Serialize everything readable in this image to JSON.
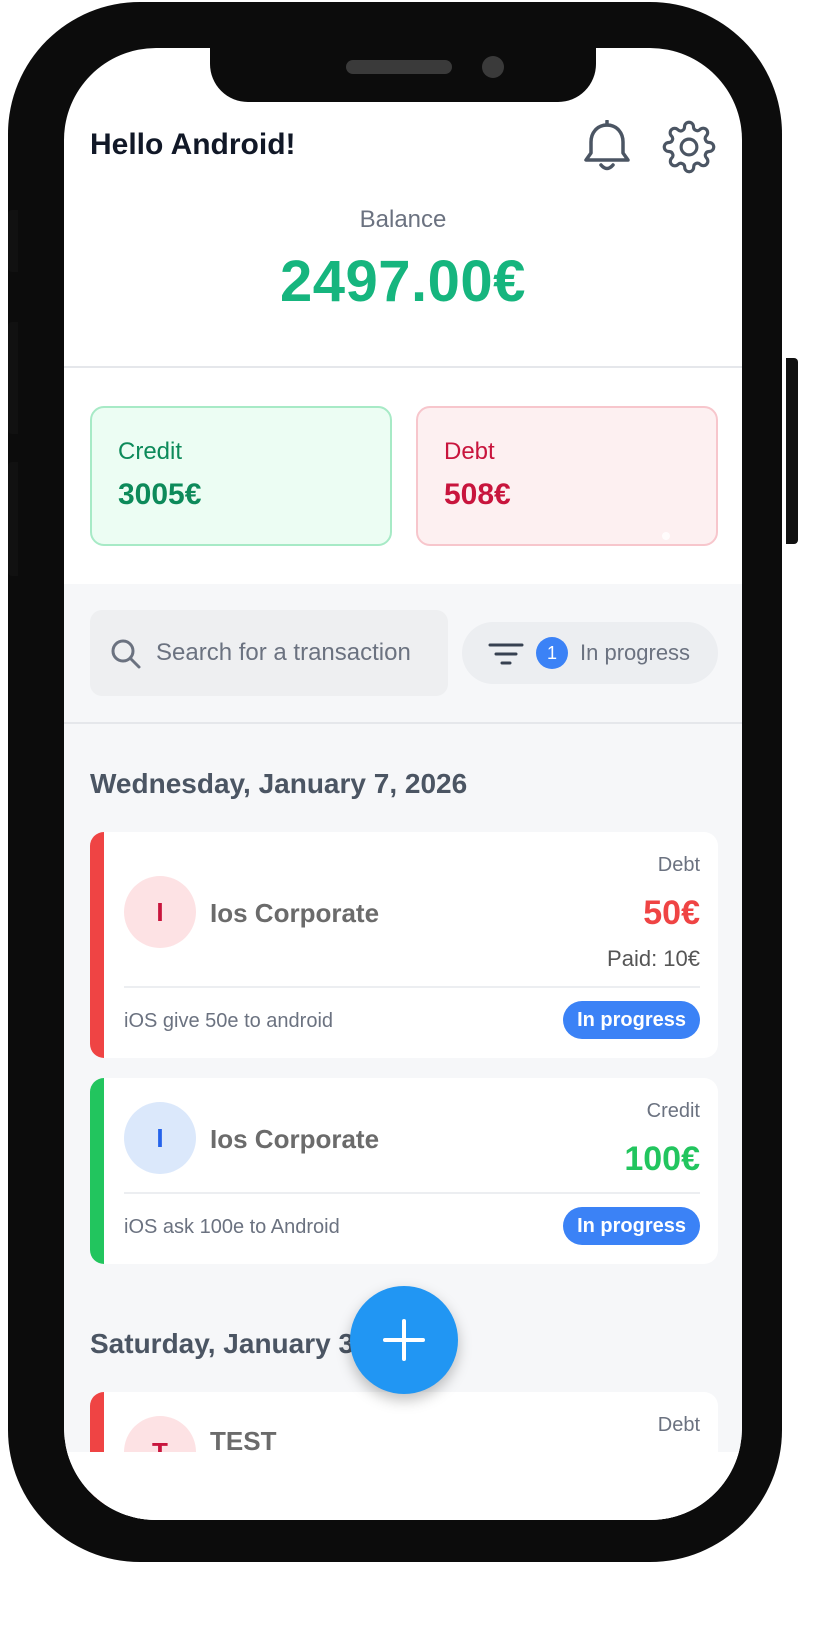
{
  "header": {
    "greeting": "Hello Android!",
    "icons": [
      "bell-icon",
      "gear-icon"
    ]
  },
  "balance": {
    "label": "Balance",
    "value": "2497.00€"
  },
  "summary": {
    "credit": {
      "label": "Credit",
      "value": "3005€"
    },
    "debt": {
      "label": "Debt",
      "value": "508€"
    }
  },
  "search": {
    "placeholder": "Search for a transaction",
    "value": ""
  },
  "filter": {
    "count": "1",
    "label": "In progress"
  },
  "groups": [
    {
      "date": "Wednesday, January 7, 2026",
      "transactions": [
        {
          "initial": "I",
          "name": "Ios Corporate",
          "type": "Debt",
          "amount": "50€",
          "paid": "Paid: 10€",
          "description": "iOS give 50e to android",
          "status": "In progress"
        },
        {
          "initial": "I",
          "name": "Ios Corporate",
          "type": "Credit",
          "amount": "100€",
          "description": "iOS ask 100e to Android",
          "status": "In progress"
        }
      ]
    },
    {
      "date": "Saturday, January 3,",
      "transactions": [
        {
          "initial": "T",
          "name": "TEST",
          "type": "Debt"
        }
      ]
    }
  ],
  "colors": {
    "balance": "#16b57e",
    "credit": "#0d8a5a",
    "debt": "#c8153d",
    "debt_bar": "#ef4444",
    "credit_bar": "#22c55e",
    "status": "#3b82f6",
    "fab": "#2196f3"
  }
}
